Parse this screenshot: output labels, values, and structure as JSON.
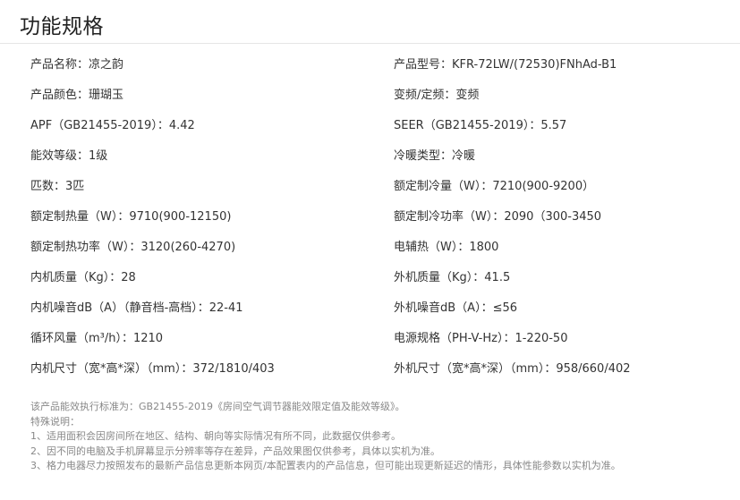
{
  "section_title": "功能规格",
  "specs": [
    {
      "left": "产品名称：凉之韵",
      "right": "产品型号：KFR-72LW/(72530)FNhAd-B1"
    },
    {
      "left": "产品颜色：珊瑚玉",
      "right": "变频/定频：变频"
    },
    {
      "left": "APF（GB21455-2019）：4.42",
      "right": "SEER（GB21455-2019）：5.57"
    },
    {
      "left": "能效等级：1级",
      "right": "冷暖类型：冷暖"
    },
    {
      "left": "匹数：3匹",
      "right": "额定制冷量（W）：7210(900-9200）"
    },
    {
      "left": "额定制热量（W）：9710(900-12150)",
      "right": "额定制冷功率（W）：2090（300-3450"
    },
    {
      "left": "额定制热功率（W）：3120(260-4270)",
      "right": "电辅热（W）：1800"
    },
    {
      "left": "内机质量（Kg）：28",
      "right": "外机质量（Kg）：41.5"
    },
    {
      "left": "内机噪音dB（A）（静音档-高档）：22-41",
      "right": "外机噪音dB（A）：≤56"
    },
    {
      "left": "循环风量（m³/h）：1210",
      "right": "电源规格（PH-V-Hz）：1-220-50"
    },
    {
      "left": "内机尺寸（宽*高*深）（mm）：372/1810/403",
      "right": "外机尺寸（宽*高*深）（mm）：958/660/402"
    }
  ],
  "notes": [
    "该产品能效执行标准为：GB21455-2019《房间空气调节器能效限定值及能效等级》。",
    "特殊说明：",
    "1、适用面积会因房间所在地区、结构、朝向等实际情况有所不同，此数据仅供参考。",
    "2、因不同的电脑及手机屏幕显示分辨率等存在差异，产品效果图仅供参考，具体以实机为准。",
    "3、格力电器尽力按照发布的最新产品信息更新本网页/本配置表内的产品信息，但可能出现更新延迟的情形，具体性能参数以实机为准。"
  ]
}
